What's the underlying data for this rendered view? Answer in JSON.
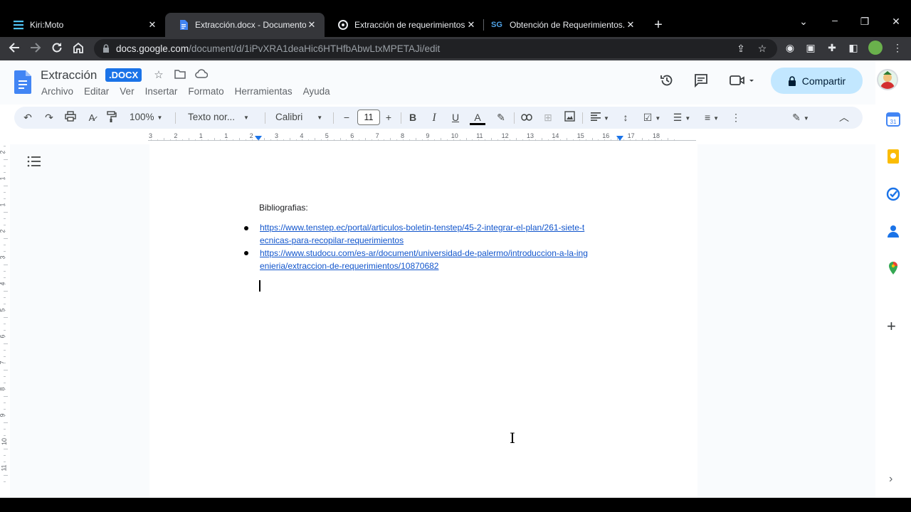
{
  "browser": {
    "tabs": [
      {
        "title": "Kiri:Moto",
        "active": false
      },
      {
        "title": "Extracción.docx - Documentos de Google",
        "active": true
      },
      {
        "title": "Extracción de requerimientos - E",
        "active": false
      },
      {
        "title": "Obtención de Requerimientos. Té",
        "active": false
      }
    ],
    "url_host": "docs.google.com",
    "url_path": "/document/d/1iPvXRA1deaHic6HTHfbAbwLtxMPETAJi/edit"
  },
  "docs": {
    "title": "Extracción",
    "badge": ".DOCX",
    "menu": [
      "Archivo",
      "Editar",
      "Ver",
      "Insertar",
      "Formato",
      "Herramientas",
      "Ayuda"
    ],
    "share_label": "Compartir"
  },
  "format_toolbar": {
    "zoom": "100%",
    "style": "Texto nor...",
    "font": "Calibri",
    "font_size": "11"
  },
  "ruler": {
    "numbers": [
      "3",
      "2",
      "1",
      "1",
      "2",
      "3",
      "4",
      "5",
      "6",
      "7",
      "8",
      "9",
      "10",
      "11",
      "12",
      "13",
      "14",
      "15",
      "16",
      "17",
      "18"
    ]
  },
  "vertical_ruler": {
    "numbers": [
      "2",
      "1",
      "1",
      "2",
      "3",
      "4",
      "5",
      "6",
      "7",
      "8",
      "9",
      "10",
      "11"
    ]
  },
  "document": {
    "heading": "Bibliografias:",
    "links": [
      {
        "line1": "https://www.tenstep.ec/portal/articulos-boletin-tenstep/45-2-integrar-el-plan/261-siete-t",
        "line2": "ecnicas-para-recopilar-requerimientos"
      },
      {
        "line1": "https://www.studocu.com/es-ar/document/universidad-de-palermo/introduccion-a-la-ing",
        "line2": "enieria/extraccion-de-requerimientos/10870682"
      }
    ]
  },
  "colors": {
    "chrome_dark": "#35363a",
    "docs_blue": "#1a73e8",
    "share_bg": "#c2e7ff",
    "link": "#1155cc"
  }
}
